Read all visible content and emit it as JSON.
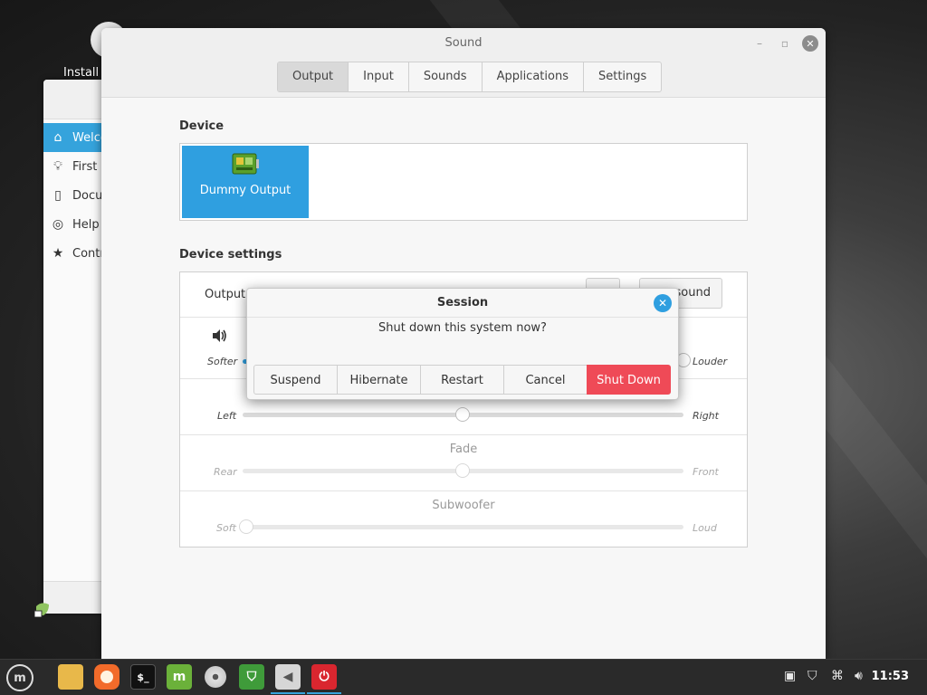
{
  "desktop": {
    "install_label": "Install"
  },
  "welcome": {
    "items": [
      {
        "label": "Welco",
        "icon": "home-icon",
        "active": true
      },
      {
        "label": "First S",
        "icon": "lightbulb-icon",
        "active": false
      },
      {
        "label": "Docu",
        "icon": "book-icon",
        "active": false
      },
      {
        "label": "Help",
        "icon": "lifebuoy-icon",
        "active": false
      },
      {
        "label": "Contr",
        "icon": "star-icon",
        "active": false
      }
    ]
  },
  "sound": {
    "title": "Sound",
    "tabs": [
      "Output",
      "Input",
      "Sounds",
      "Applications",
      "Settings"
    ],
    "active_tab": "Output",
    "device_title": "Device",
    "device_name": "Dummy Output",
    "device_settings_title": "Device settings",
    "output_label": "Output",
    "test_sound_label": "sound",
    "volume": {
      "left": "Softer",
      "right": "Louder",
      "level": 0
    },
    "balance": {
      "left": "Left",
      "right": "Right",
      "value": 0.5
    },
    "fade": {
      "title": "Fade",
      "left": "Rear",
      "right": "Front",
      "value": 0.5
    },
    "subwoofer": {
      "title": "Subwoofer",
      "left": "Soft",
      "right": "Loud",
      "value": 0
    }
  },
  "session_dialog": {
    "title": "Session",
    "message": "Shut down this system now?",
    "buttons": {
      "suspend": "Suspend",
      "hibernate": "Hibernate",
      "restart": "Restart",
      "cancel": "Cancel",
      "shutdown": "Shut Down"
    },
    "accent": "#2f9fe0",
    "danger": "#ef4a57"
  },
  "taskbar": {
    "clock": "11:53",
    "apps": [
      "menu-icon",
      "folder-icon",
      "firefox-icon",
      "terminal-icon",
      "mintupdate-icon",
      "disc-icon",
      "shield-icon",
      "sound-settings-icon",
      "power-icon"
    ]
  }
}
